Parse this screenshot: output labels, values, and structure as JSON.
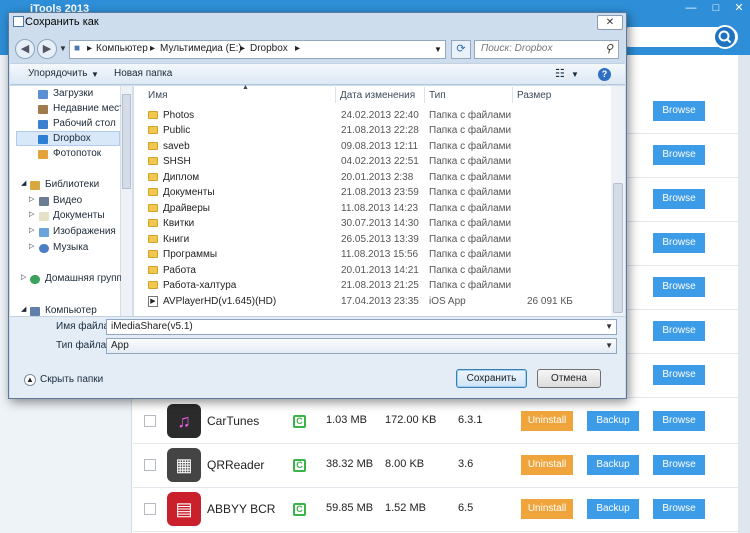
{
  "app": {
    "title": "iTools 2013"
  },
  "background_rows": [
    {
      "name": "",
      "size1": "",
      "size2": "",
      "version": "",
      "browse": "Browse",
      "top": 0
    },
    {
      "name": "",
      "size1": "",
      "size2": "",
      "version": "",
      "browse": "Browse",
      "top": 0
    }
  ],
  "apps": [
    {
      "name": "CarTunes",
      "app_size": "1.03 MB",
      "doc_size": "172.00 KB",
      "version": "6.3.1",
      "uninstall": "Uninstall",
      "backup": "Backup",
      "browse": "Browse",
      "icon": "music-note-icon",
      "color": "#2b2b2b"
    },
    {
      "name": "QRReader",
      "app_size": "38.32 MB",
      "doc_size": "8.00 KB",
      "version": "3.6",
      "uninstall": "Uninstall",
      "backup": "Backup",
      "browse": "Browse",
      "icon": "qr-code-icon",
      "color": "#444444"
    },
    {
      "name": "ABBYY BCR",
      "app_size": "59.85 MB",
      "doc_size": "1.52 MB",
      "version": "6.5",
      "uninstall": "Uninstall",
      "backup": "Backup",
      "browse": "Browse",
      "icon": "business-card-icon",
      "color": "#c9202c"
    }
  ],
  "browse_label": "Browse",
  "dialog": {
    "title": "Сохранить как",
    "breadcrumb": [
      "Компьютер",
      "Мультимедиа (E:)",
      "Dropbox"
    ],
    "search_placeholder": "Поиск: Dropbox",
    "organize": "Упорядочить",
    "new_folder": "Новая папка",
    "nav": {
      "downloads": "Загрузки",
      "recent": "Недавние места",
      "desktop": "Рабочий стол",
      "dropbox": "Dropbox",
      "photostream": "Фотопоток",
      "libraries": "Библиотеки",
      "video": "Видео",
      "documents": "Документы",
      "images": "Изображения",
      "music": "Музыка",
      "homegroup": "Домашняя группа",
      "computer": "Компьютер"
    },
    "columns": {
      "name": "Имя",
      "date": "Дата изменения",
      "type": "Тип",
      "size": "Размер"
    },
    "files": [
      {
        "name": "Photos",
        "date": "24.02.2013 22:40",
        "type": "Папка с файлами",
        "size": ""
      },
      {
        "name": "Public",
        "date": "21.08.2013 22:28",
        "type": "Папка с файлами",
        "size": ""
      },
      {
        "name": "saveb",
        "date": "09.08.2013 12:11",
        "type": "Папка с файлами",
        "size": ""
      },
      {
        "name": "SHSH",
        "date": "04.02.2013 22:51",
        "type": "Папка с файлами",
        "size": ""
      },
      {
        "name": "Диплом",
        "date": "20.01.2013 2:38",
        "type": "Папка с файлами",
        "size": ""
      },
      {
        "name": "Документы",
        "date": "21.08.2013 23:59",
        "type": "Папка с файлами",
        "size": ""
      },
      {
        "name": "Драйверы",
        "date": "11.08.2013 14:23",
        "type": "Папка с файлами",
        "size": ""
      },
      {
        "name": "Квитки",
        "date": "30.07.2013 14:30",
        "type": "Папка с файлами",
        "size": ""
      },
      {
        "name": "Книги",
        "date": "26.05.2013 13:39",
        "type": "Папка с файлами",
        "size": ""
      },
      {
        "name": "Программы",
        "date": "11.08.2013 15:56",
        "type": "Папка с файлами",
        "size": ""
      },
      {
        "name": "Работа",
        "date": "20.01.2013 14:21",
        "type": "Папка с файлами",
        "size": ""
      },
      {
        "name": "Работа-халтура",
        "date": "21.08.2013 21:25",
        "type": "Папка с файлами",
        "size": ""
      },
      {
        "name": "AVPlayerHD(v1.645)(HD)",
        "date": "17.04.2013 23:35",
        "type": "iOS App",
        "size": "26 091 КБ"
      }
    ],
    "filename_label": "Имя файла:",
    "filename_value": "iMediaShare(v5.1)",
    "filetype_label": "Тип файла:",
    "filetype_value": "App",
    "hide_folders": "Скрыть папки",
    "save": "Сохранить",
    "cancel": "Отмена"
  }
}
